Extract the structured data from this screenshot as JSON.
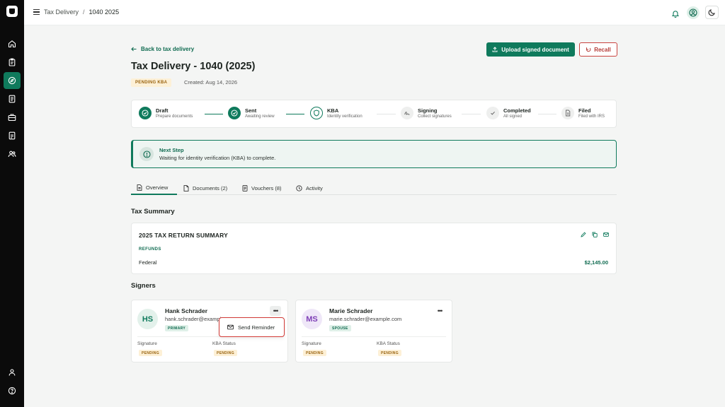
{
  "breadcrumb": {
    "parent": "Tax Delivery",
    "separator": "/",
    "current": "1040 2025"
  },
  "back_link": "Back to tax delivery",
  "actions": {
    "upload": "Upload signed document",
    "recall": "Recall"
  },
  "page_title": "Tax Delivery - 1040 (2025)",
  "status_badge": "PENDING KBA",
  "created": "Created: Aug 14, 2026",
  "steps": [
    {
      "label": "Draft",
      "sub": "Prepare documents",
      "state": "done"
    },
    {
      "label": "Sent",
      "sub": "Awaiting review",
      "state": "done"
    },
    {
      "label": "KBA",
      "sub": "Identity verification",
      "state": "current"
    },
    {
      "label": "Signing",
      "sub": "Collect signatures",
      "state": "todo"
    },
    {
      "label": "Completed",
      "sub": "All signed",
      "state": "todo"
    },
    {
      "label": "Filed",
      "sub": "Filed with IRS",
      "state": "todo"
    }
  ],
  "next_step": {
    "title": "Next Step",
    "description": "Waiting for identity verification (KBA) to complete."
  },
  "tabs": [
    {
      "label": "Overview",
      "icon": "document-icon",
      "active": true
    },
    {
      "label": "Documents (2)",
      "icon": "file-icon",
      "active": false
    },
    {
      "label": "Vouchers (8)",
      "icon": "receipt-icon",
      "active": false
    },
    {
      "label": "Activity",
      "icon": "clock-icon",
      "active": false
    }
  ],
  "tax_summary": {
    "section_title": "Tax Summary",
    "card_title": "2025 TAX RETURN SUMMARY",
    "refunds_label": "REFUNDS",
    "row_label": "Federal",
    "row_amount": "$2,145.00"
  },
  "signers_title": "Signers",
  "signers": [
    {
      "initials": "HS",
      "name": "Hank Schrader",
      "email": "hank.schrader@example.com",
      "role": "PRIMARY",
      "signature_label": "Signature",
      "signature_status": "PENDING",
      "kba_label": "KBA Status",
      "kba_status": "PENDING"
    },
    {
      "initials": "MS",
      "name": "Marie Schrader",
      "email": "marie.schrader@example.com",
      "role": "SPOUSE",
      "signature_label": "Signature",
      "signature_status": "PENDING",
      "kba_label": "KBA Status",
      "kba_status": "PENDING"
    }
  ],
  "menu": {
    "send_reminder": "Send Reminder"
  },
  "colors": {
    "accent": "#0f7a5c",
    "danger": "#c9433f",
    "pending_bg": "#fdf0d6",
    "pending_text": "#9a6410",
    "sidebar_bg": "#0b0b0b"
  }
}
